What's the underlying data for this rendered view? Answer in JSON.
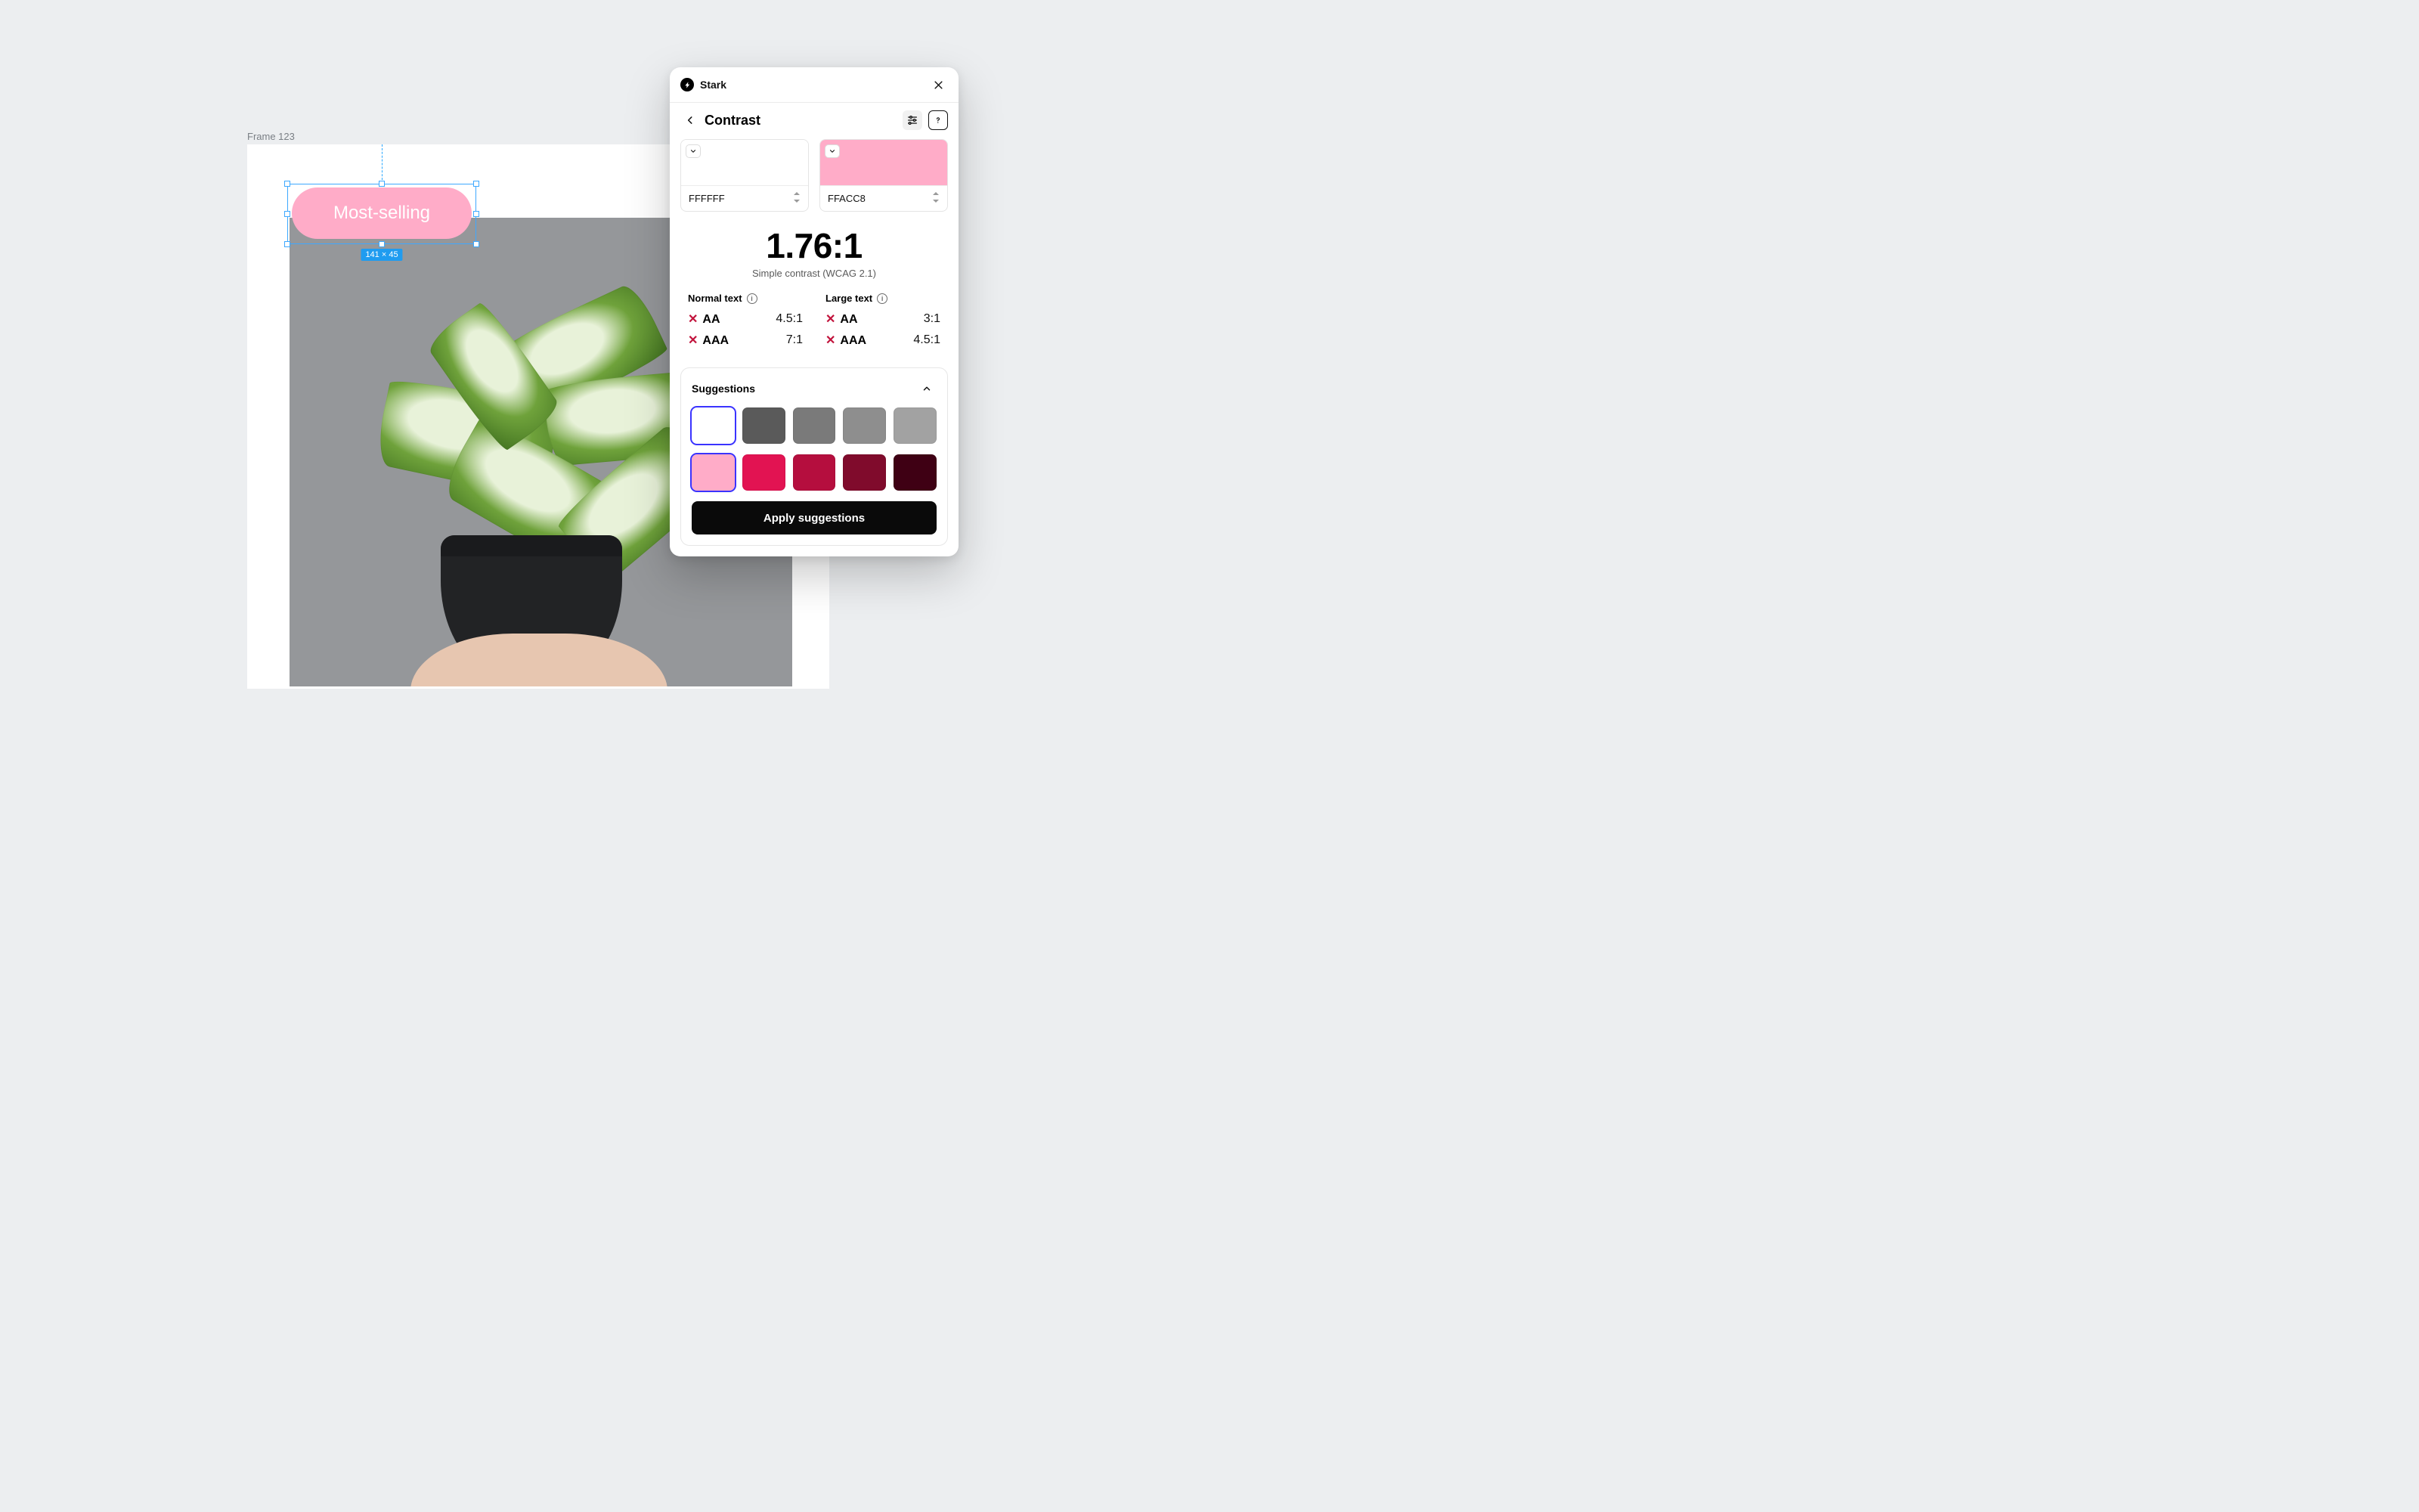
{
  "canvas": {
    "frame_label": "Frame 123",
    "selected_element": {
      "text": "Most-selling",
      "size_badge": "141 × 45",
      "fill": "#ffacc8",
      "text_color": "#ffffff"
    }
  },
  "panel": {
    "app_name": "Stark",
    "section_title": "Contrast",
    "foreground": {
      "hex": "FFFFFF",
      "swatch": "#ffffff"
    },
    "background": {
      "hex": "FFACC8",
      "swatch": "#ffacc8"
    },
    "ratio_value": "1.76:1",
    "ratio_caption": "Simple contrast (WCAG 2.1)",
    "normal_text_label": "Normal text",
    "large_text_label": "Large text",
    "results": {
      "normal": {
        "aa_label": "AA",
        "aa_req": "4.5:1",
        "aaa_label": "AAA",
        "aaa_req": "7:1"
      },
      "large": {
        "aa_label": "AA",
        "aa_req": "3:1",
        "aaa_label": "AAA",
        "aaa_req": "4.5:1"
      }
    },
    "suggestions_label": "Suggestions",
    "suggestions_row1": [
      "#ffffff",
      "#5a5a5a",
      "#7a7a7a",
      "#8e8e8e",
      "#a2a2a2"
    ],
    "suggestions_row2": [
      "#ffacc8",
      "#e21352",
      "#b50e3e",
      "#800b2c",
      "#3f0014"
    ],
    "apply_label": "Apply suggestions"
  }
}
